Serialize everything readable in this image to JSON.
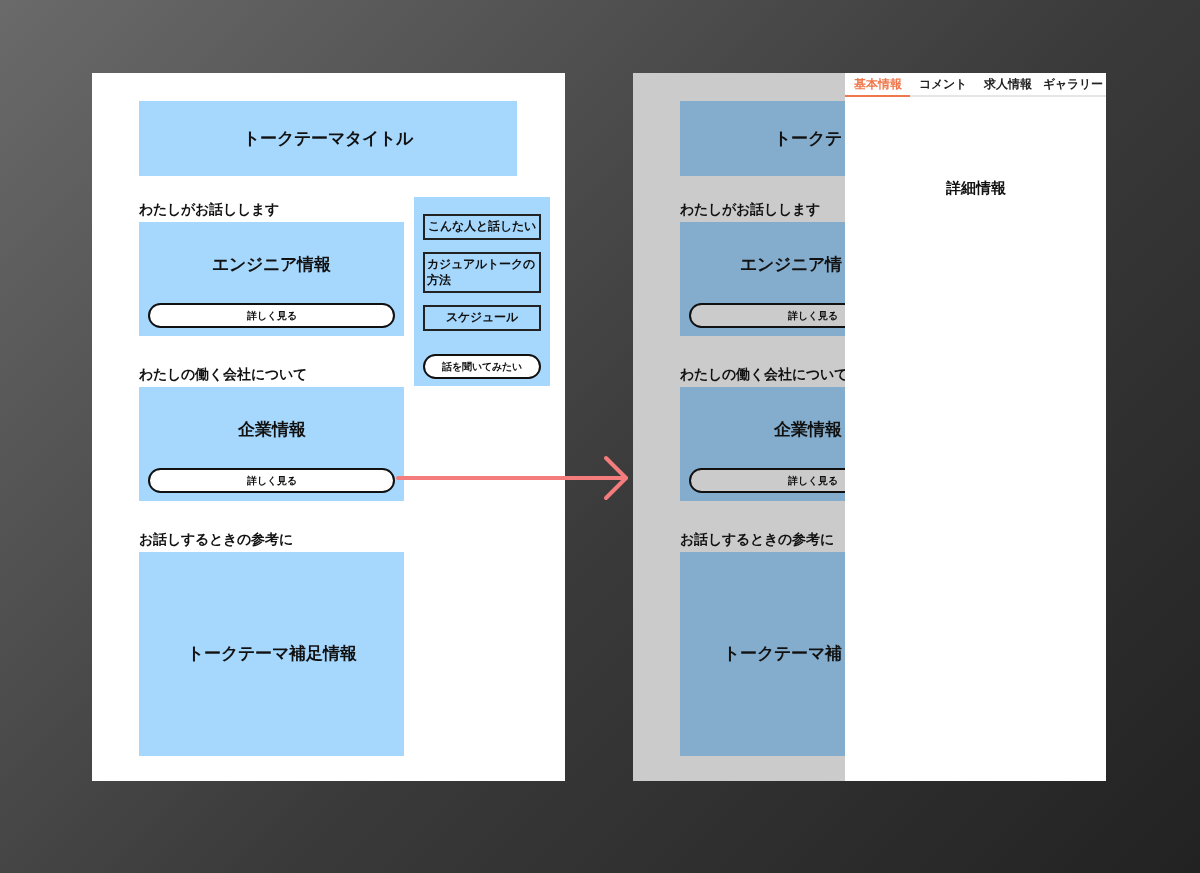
{
  "main_screen": {
    "title": "トークテーマタイトル",
    "sections": [
      {
        "heading": "わたしがお話しします",
        "card": {
          "title": "エンジニア情報",
          "button": "詳しく見る"
        }
      },
      {
        "heading": "わたしの働く会社について",
        "card": {
          "title": "企業情報",
          "button": "詳しく見る"
        }
      },
      {
        "heading": "お話しするときの参考に",
        "card": {
          "title": "トークテーマ補足情報"
        }
      }
    ],
    "sidebar": {
      "links": [
        "こんな人と話したい",
        "カジュアルトークの方法",
        "スケジュール"
      ],
      "button": "話を聞いてみたい"
    }
  },
  "detail_screen": {
    "background": {
      "title": "トークテ",
      "sections": [
        {
          "heading": "わたしがお話しします",
          "card": {
            "title": "エンジニア情",
            "button": "詳しく見る"
          }
        },
        {
          "heading": "わたしの働く会社について",
          "card": {
            "title": "企業情報",
            "button": "詳しく見る"
          }
        },
        {
          "heading": "お話しするときの参考に",
          "card": {
            "title": "トークテーマ補"
          }
        }
      ]
    },
    "drawer": {
      "tabs": [
        {
          "label": "基本情報",
          "selected": true
        },
        {
          "label": "コメント",
          "selected": false
        },
        {
          "label": "求人情報",
          "selected": false
        },
        {
          "label": "ギャラリー",
          "selected": false
        }
      ],
      "content": "詳細情報"
    }
  }
}
